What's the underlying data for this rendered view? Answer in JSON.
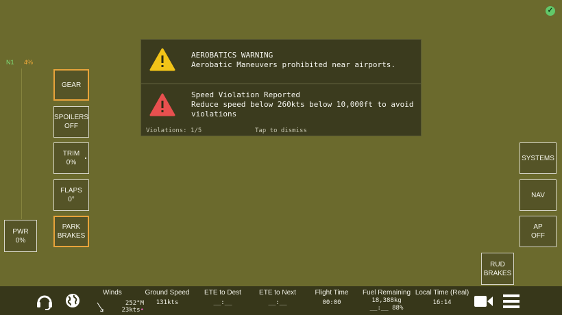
{
  "status": {
    "ok_icon": "check-circle-icon",
    "ok_color": "#62c86a"
  },
  "engine": {
    "n1_label": "N1",
    "n1_value": "4%"
  },
  "controls": {
    "gear": "GEAR",
    "spoilers": "SPOILERS\nOFF",
    "trim": "TRIM\n0%",
    "flaps": "FLAPS\n0°",
    "park_brakes": "PARK\nBRAKES",
    "pwr": "PWR\n0%",
    "systems": "SYSTEMS",
    "nav": "NAV",
    "ap": "AP\nOFF",
    "rud_brakes": "RUD\nBRAKES"
  },
  "notifications": {
    "items": [
      {
        "icon": "yellow-warning-icon",
        "color": "#f2c418",
        "title": "AEROBATICS WARNING",
        "message": "Aerobatic Maneuvers prohibited near airports."
      },
      {
        "icon": "red-warning-icon",
        "color": "#e8504f",
        "title": "Speed Violation Reported",
        "message": "Reduce speed below 260kts below 10,000ft to avoid violations"
      }
    ],
    "violations": "Violations: 1/5",
    "dismiss": "Tap to dismiss"
  },
  "bottom_bar": {
    "winds": {
      "label": "Winds",
      "direction": "252°M",
      "speed": "23kts"
    },
    "ground_speed": {
      "label": "Ground Speed",
      "value": "131kts"
    },
    "ete_dest": {
      "label": "ETE to Dest",
      "value": "__:__"
    },
    "ete_next": {
      "label": "ETE to Next",
      "value": "__:__"
    },
    "flight_time": {
      "label": "Flight Time",
      "value": "00:00"
    },
    "fuel": {
      "label": "Fuel Remaining",
      "weight": "18,388kg",
      "time_pct": "__:__ 88%"
    },
    "local_time": {
      "label": "Local Time (Real)",
      "value": "16:14"
    }
  }
}
